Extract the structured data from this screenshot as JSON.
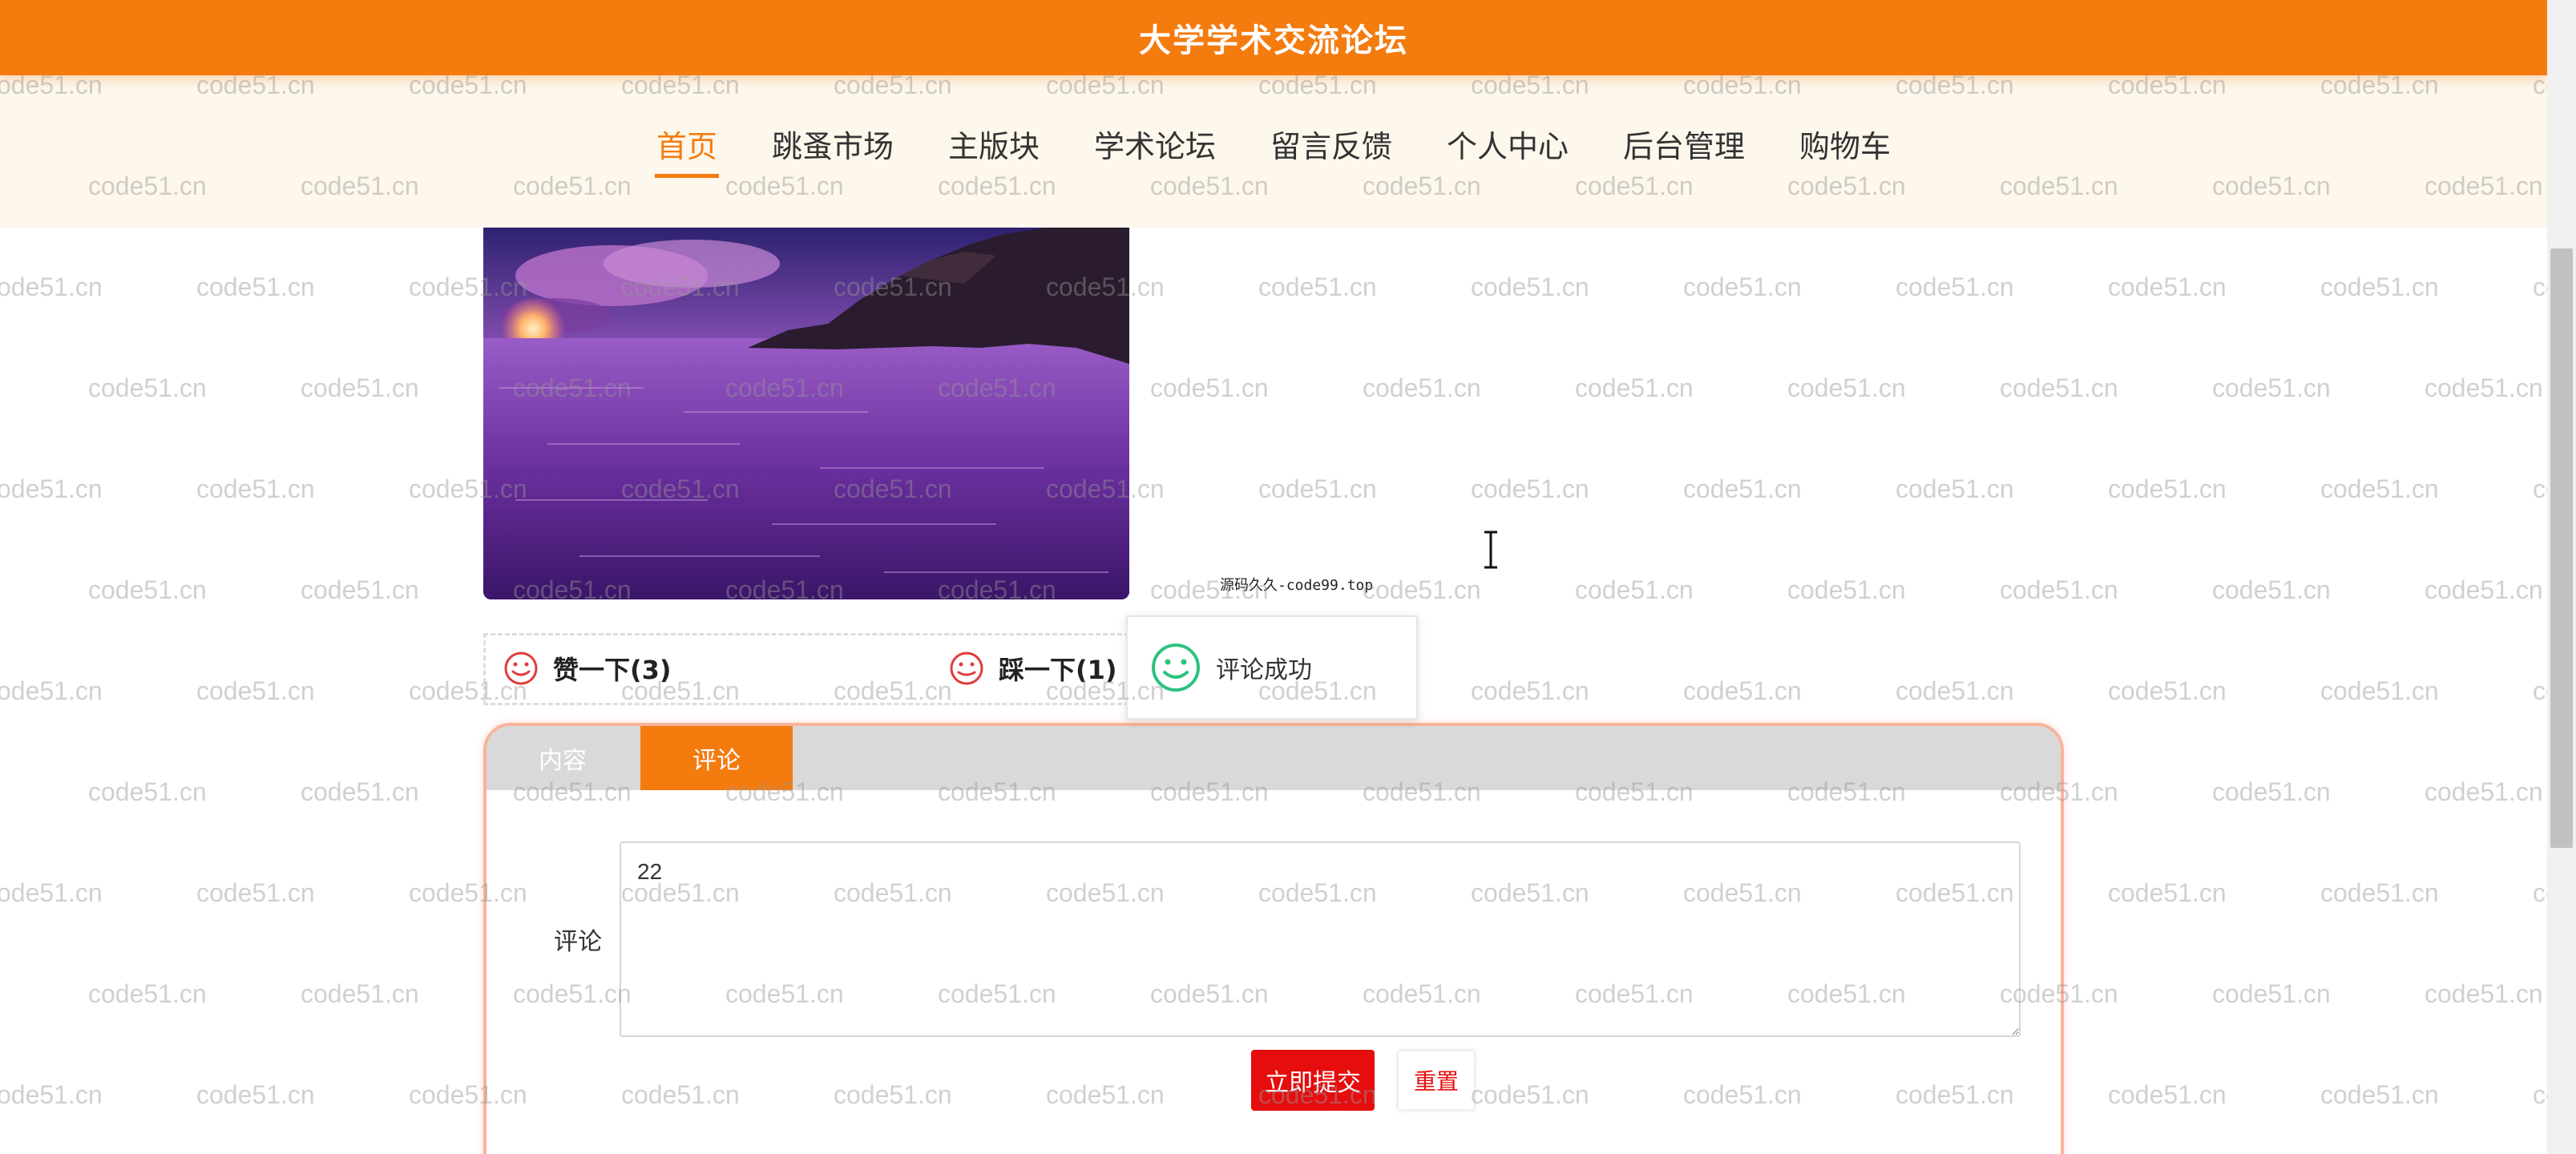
{
  "site": {
    "title": "大学学术交流论坛"
  },
  "nav": {
    "items": [
      {
        "label": "首页",
        "active": true
      },
      {
        "label": "跳蚤市场",
        "active": false
      },
      {
        "label": "主版块",
        "active": false
      },
      {
        "label": "学术论坛",
        "active": false
      },
      {
        "label": "留言反馈",
        "active": false
      },
      {
        "label": "个人中心",
        "active": false
      },
      {
        "label": "后台管理",
        "active": false
      },
      {
        "label": "购物车",
        "active": false
      }
    ]
  },
  "watermark": {
    "text": "code51.cn"
  },
  "votes": {
    "like_label": "赞一下(3)",
    "dislike_label": "踩一下(1)",
    "icon_color": "#e03c3c"
  },
  "tooltip": {
    "text": "源码久久-code99.top"
  },
  "toast": {
    "message": "评论成功",
    "icon": "smile-icon",
    "icon_color": "#2ec27e"
  },
  "tabs": [
    {
      "label": "内容",
      "active": false
    },
    {
      "label": "评论",
      "active": true
    }
  ],
  "comment_form": {
    "label": "评论",
    "value": "22",
    "submit_label": "立即提交",
    "reset_label": "重置"
  },
  "colors": {
    "brand": "#f47b0e",
    "nav_bg": "#fdf7ec",
    "submit": "#e50d0d",
    "panel_border": "#f7b49a"
  }
}
